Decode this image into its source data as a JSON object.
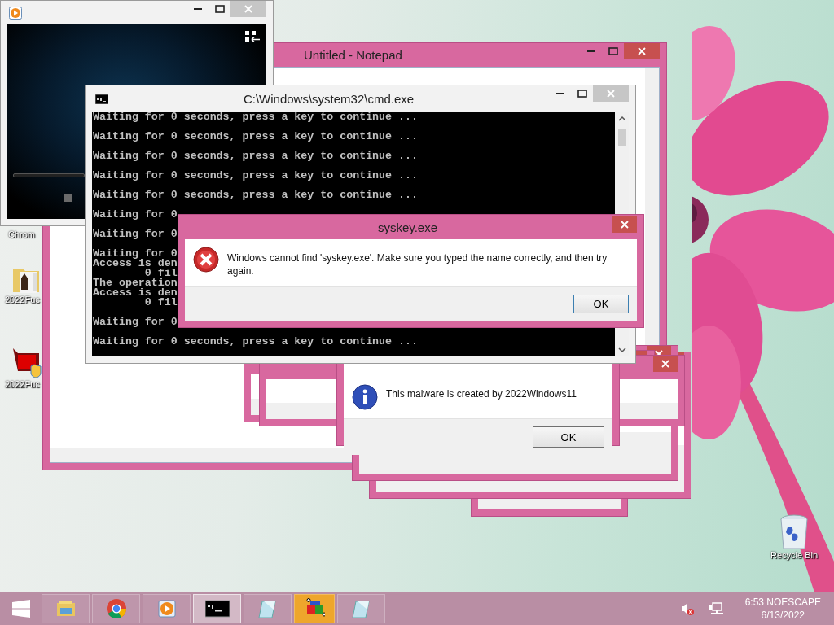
{
  "desktop_icons": [
    {
      "kind": "browser",
      "label": "Chrom"
    },
    {
      "kind": "folder",
      "label": "2022Fuc"
    },
    {
      "kind": "program",
      "label": "2022Fuc"
    },
    {
      "kind": "recycle",
      "label": "Recycle Bin"
    }
  ],
  "windows": [
    {
      "kind": "notepad",
      "title": "Untitled - Notepad"
    },
    {
      "kind": "frame"
    },
    {
      "kind": "frame"
    },
    {
      "kind": "frame"
    },
    {
      "kind": "frame"
    },
    {
      "kind": "frame"
    },
    {
      "kind": "message",
      "text": "This malware is created by 2022Windows11",
      "button": "OK"
    },
    {
      "kind": "media"
    },
    {
      "kind": "console",
      "title": "C:\\Windows\\system32\\cmd.exe",
      "blocks": [
        [
          "Waiting for 0 seconds, press a key to continue ..."
        ],
        [
          "Waiting for 0 seconds, press a key to continue ..."
        ],
        [
          "Waiting for 0 seconds, press a key to continue ..."
        ],
        [
          "Waiting for 0 seconds, press a key to continue ..."
        ],
        [
          "Waiting for 0 seconds, press a key to continue ..."
        ],
        [
          "Waiting for 0"
        ],
        [
          "Waiting for 0"
        ],
        [
          "Waiting for 0",
          "Access is den",
          "        0 fil",
          "The operation",
          "Access is den",
          "        0 fil"
        ],
        [
          "Waiting for 0"
        ],
        [
          "Waiting for 0 seconds, press a key to continue ..."
        ]
      ]
    },
    {
      "kind": "error",
      "title": "syskey.exe",
      "text": "Windows cannot find 'syskey.exe'. Make sure you typed the name correctly, and then try again.",
      "button": "OK"
    }
  ],
  "taskbar": {
    "items": [
      {
        "kind": "start",
        "selected": false,
        "attention": false
      },
      {
        "kind": "explorer",
        "selected": false,
        "attention": false
      },
      {
        "kind": "chrome",
        "selected": false,
        "attention": false
      },
      {
        "kind": "media",
        "selected": false,
        "attention": false
      },
      {
        "kind": "console",
        "selected": true,
        "attention": false
      },
      {
        "kind": "notepad",
        "selected": false,
        "attention": false
      },
      {
        "kind": "paint",
        "selected": false,
        "attention": true
      },
      {
        "kind": "notepad",
        "selected": false,
        "attention": false
      }
    ],
    "tray": [
      {
        "kind": "volume-muted"
      },
      {
        "kind": "network"
      }
    ],
    "clock": {
      "time": "6:53 NOESCAPE",
      "date": "6/13/2022"
    }
  }
}
